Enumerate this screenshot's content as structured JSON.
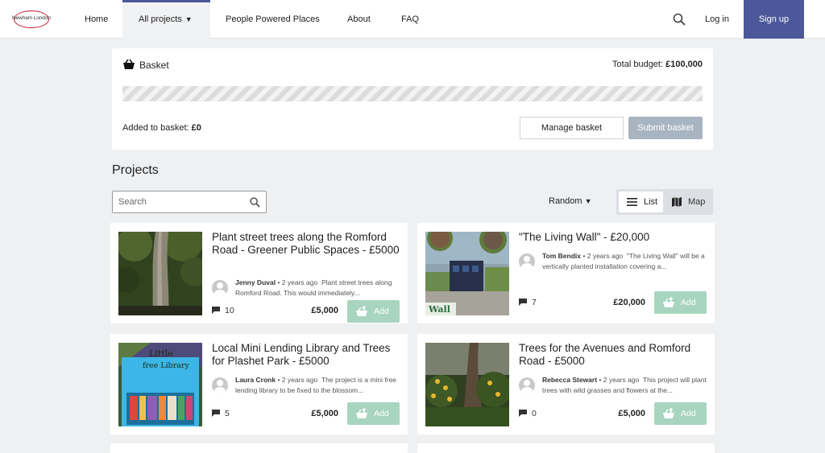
{
  "header": {
    "logo_text": "Newham London",
    "nav": {
      "home": "Home",
      "all_projects": "All projects",
      "people_powered_places": "People Powered Places",
      "about": "About",
      "faq": "FAQ"
    },
    "login": "Log in",
    "signup": "Sign up"
  },
  "basket": {
    "title": "Basket",
    "total_budget_label": "Total budget:",
    "total_budget_value": "£100,000",
    "added_label": "Added to basket:",
    "added_value": "£0",
    "manage_label": "Manage basket",
    "submit_label": "Submit basket",
    "progress": 0
  },
  "projects": {
    "heading": "Projects",
    "search_placeholder": "Search",
    "sort_label": "Random",
    "view_list_label": "List",
    "view_map_label": "Map",
    "add_label": "Add",
    "cards": [
      {
        "title": "Plant street trees along the Romford Road - Greener Public Spaces - £5000",
        "author": "Jenny Duval",
        "time": "2 years ago",
        "excerpt": "Plant street trees along Romford Road. This would immediately...",
        "comments": "10",
        "price": "£5,000"
      },
      {
        "title": "\"The Living Wall\" - £20,000",
        "author": "Tom Bendix",
        "time": "2 years ago",
        "excerpt": "\"The Living Wall\" will be a vertically planted installation covering a...",
        "comments": "7",
        "price": "£20,000",
        "image_text": "Wall"
      },
      {
        "title": "Local Mini Lending Library and Trees for Plashet Park - £5000",
        "author": "Laura Cronk",
        "time": "2 years ago",
        "excerpt": "The project is a mini free lending library to be fixed to the blossom...",
        "comments": "5",
        "price": "£5,000",
        "image_text_1": "Little",
        "image_text_2": "free Library"
      },
      {
        "title": "Trees for the Avenues and Romford Road - £5000",
        "author": "Rebecca Stewart",
        "time": "2 years ago",
        "excerpt": "This project will plant trees with wild grasses and flowers at the...",
        "comments": "0",
        "price": "£5,000"
      }
    ]
  },
  "colors": {
    "brand": "#4c589a",
    "add_button": "#a8d5bf",
    "submit_disabled": "#a9b4c2",
    "logo_red": "#c8102e"
  }
}
